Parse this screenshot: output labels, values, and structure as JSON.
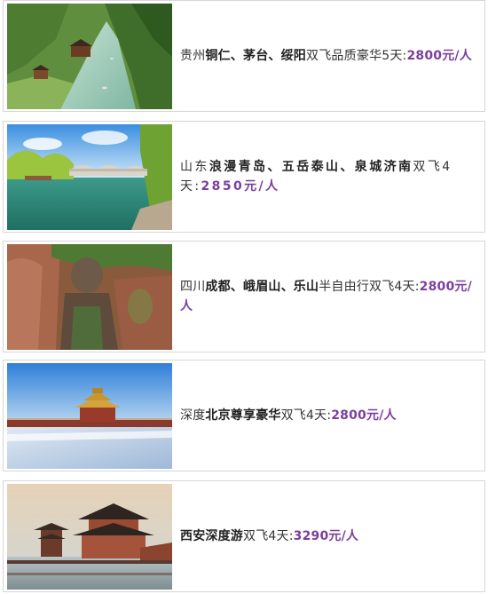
{
  "tours": [
    {
      "prefix": "贵州",
      "bold": "铜仁、茅台、绥阳",
      "suffix": "双飞品质豪华5天:",
      "price": "2800元/人",
      "image": "guizhou-river-valley-photo"
    },
    {
      "prefix": "山东",
      "bold": "浪漫青岛、五岳泰山、泉城济南",
      "suffix": "双飞4天:",
      "price": "2850元/人",
      "image": "jinan-lake-bridge-photo"
    },
    {
      "prefix": "四川",
      "bold": "成都、峨眉山、乐山",
      "suffix": "半自由行双飞4天:",
      "price": "2800元/人",
      "image": "leshan-giant-buddha-photo"
    },
    {
      "prefix": "深度",
      "bold": "北京尊享豪华",
      "suffix": "双飞4天:",
      "price": "2800元/人",
      "image": "beijing-forbidden-city-snow-photo"
    },
    {
      "prefix": "",
      "bold": "西安深度游",
      "suffix": "双飞4天:",
      "price": "3290元/人",
      "image": "xian-pagoda-lake-photo"
    }
  ],
  "colors": {
    "price": "#7b3f9e",
    "text": "#333333",
    "border": "#d6d6d6"
  }
}
